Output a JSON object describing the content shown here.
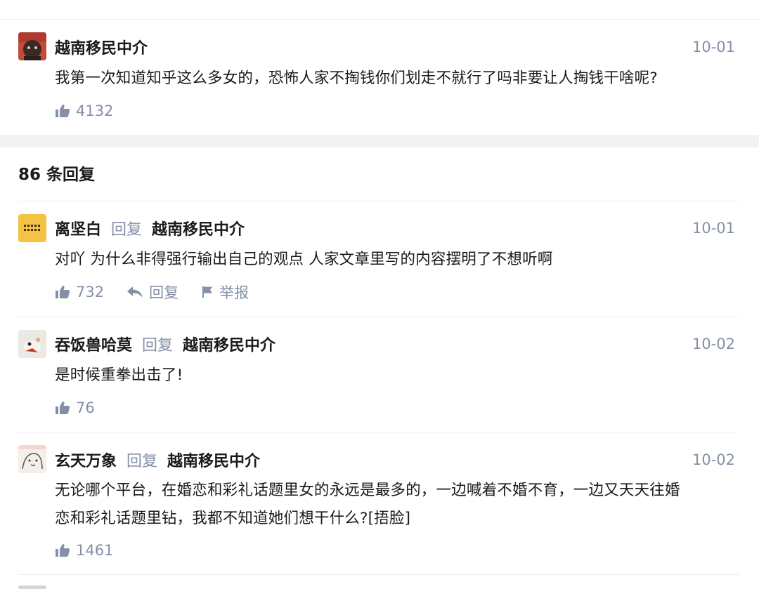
{
  "root_comment": {
    "author": "越南移民中介",
    "date": "10-01",
    "text": "我第一次知道知乎这么多女的，恐怖人家不掏钱你们划走不就行了吗非要让人掏钱干啥呢?",
    "likes": "4132"
  },
  "replies_header": "86 条回复",
  "reply_label": "回复",
  "report_label": "举报",
  "replies": [
    {
      "author": "离坚白",
      "target": "越南移民中介",
      "date": "10-01",
      "text": "对吖 为什么非得强行输出自己的观点 人家文章里写的内容摆明了不想听啊",
      "likes": "732"
    },
    {
      "author": "吞饭兽哈莫",
      "target": "越南移民中介",
      "date": "10-02",
      "text": "是时候重拳出击了!",
      "likes": "76"
    },
    {
      "author": "玄天万象",
      "target": "越南移民中介",
      "date": "10-02",
      "text_line1": "无论哪个平台，在婚恋和彩礼话题里女的永远是最多的，一边喊着不婚不育，一边又天天往婚",
      "text_line2": "恋和彩礼话题里钻，我都不知道她们想干什么?[捂脸]",
      "likes": "1461"
    }
  ],
  "icons": {
    "like": "thumbs-up-icon",
    "reply": "reply-arrow-icon",
    "report": "flag-icon"
  },
  "colors": {
    "muted": "#8590a6",
    "text": "#1a1a1a",
    "avatar_yellow": "#f5c344"
  }
}
